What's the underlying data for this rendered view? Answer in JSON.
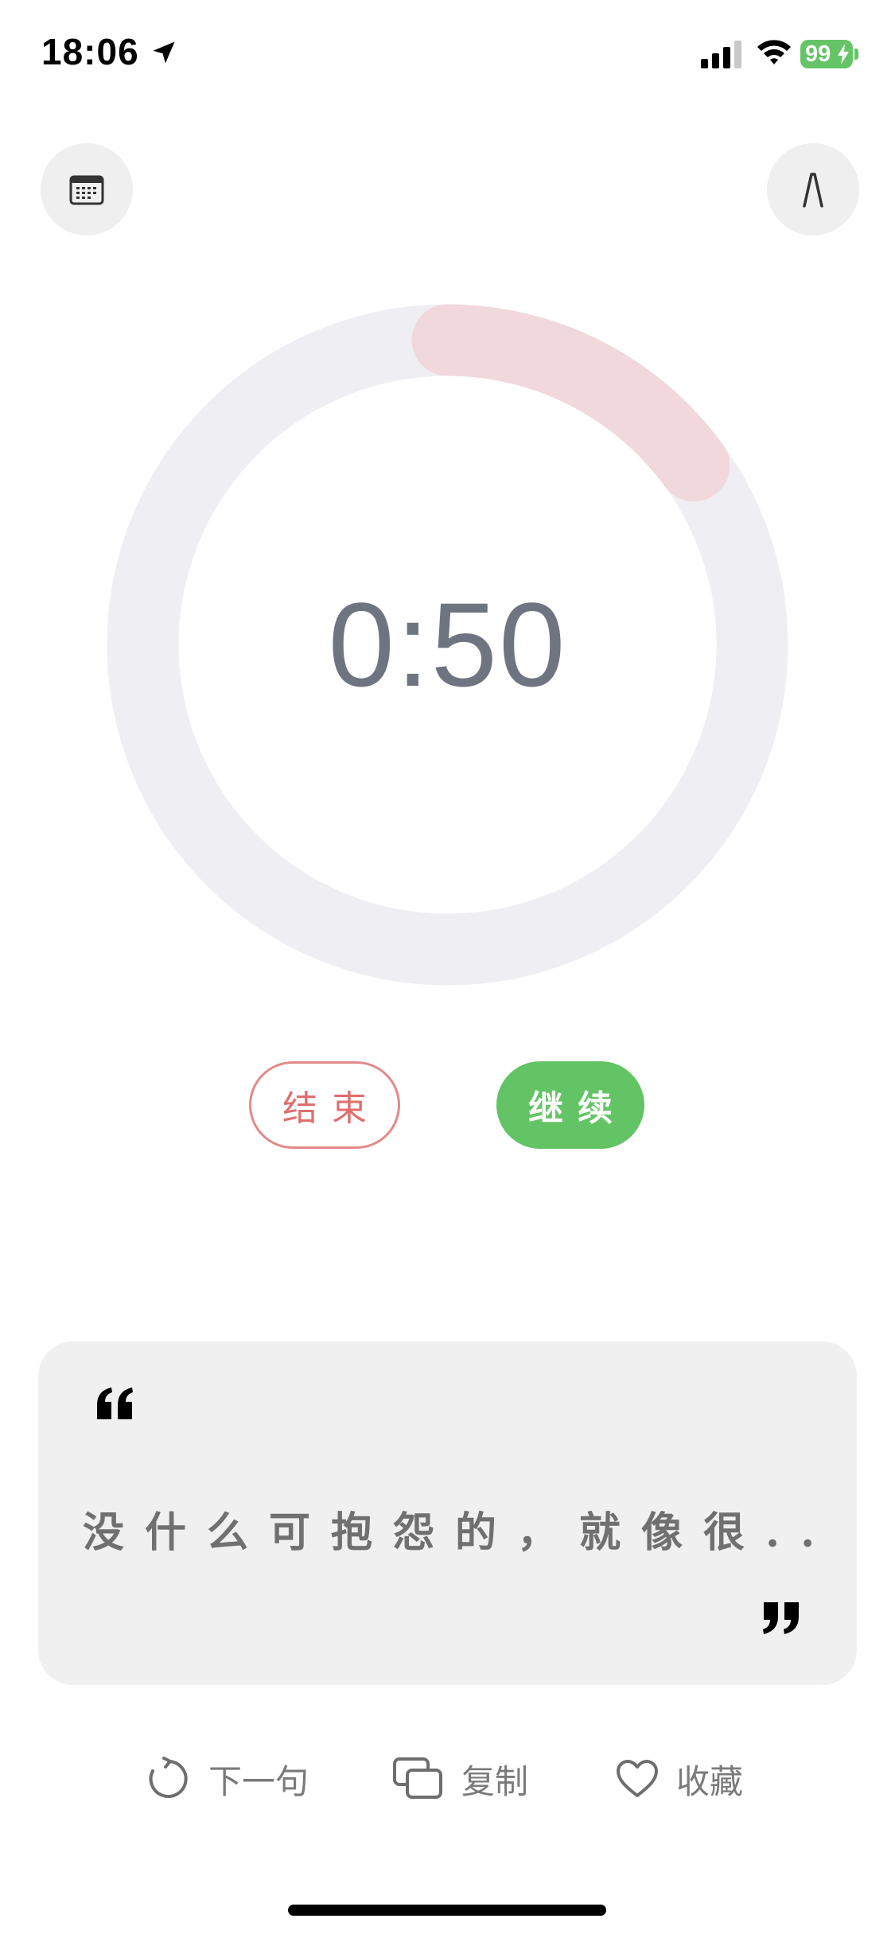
{
  "status_bar": {
    "time": "18:06",
    "battery": "99",
    "icons": [
      "location-arrow-icon",
      "cellular-signal-icon",
      "wifi-icon",
      "battery-icon"
    ]
  },
  "toolbar": {
    "left_icon": "calendar-icon",
    "right_icon": "font-icon"
  },
  "timer": {
    "display": "0:50",
    "progress": 0.15,
    "ring_color": "#efeff3",
    "progress_color": "#f0d8dc"
  },
  "buttons": {
    "end_label": "结束",
    "continue_label": "继续",
    "end_color": "#e06e6e",
    "continue_color": "#63c466"
  },
  "quote": {
    "text": "没什么可抱怨的，就像很...",
    "open_icon": "open-quote-icon",
    "close_icon": "close-quote-icon"
  },
  "actions": {
    "next_label": "下一句",
    "copy_label": "复制",
    "favorite_label": "收藏",
    "next_icon": "refresh-icon",
    "copy_icon": "copy-icon",
    "favorite_icon": "heart-icon"
  }
}
